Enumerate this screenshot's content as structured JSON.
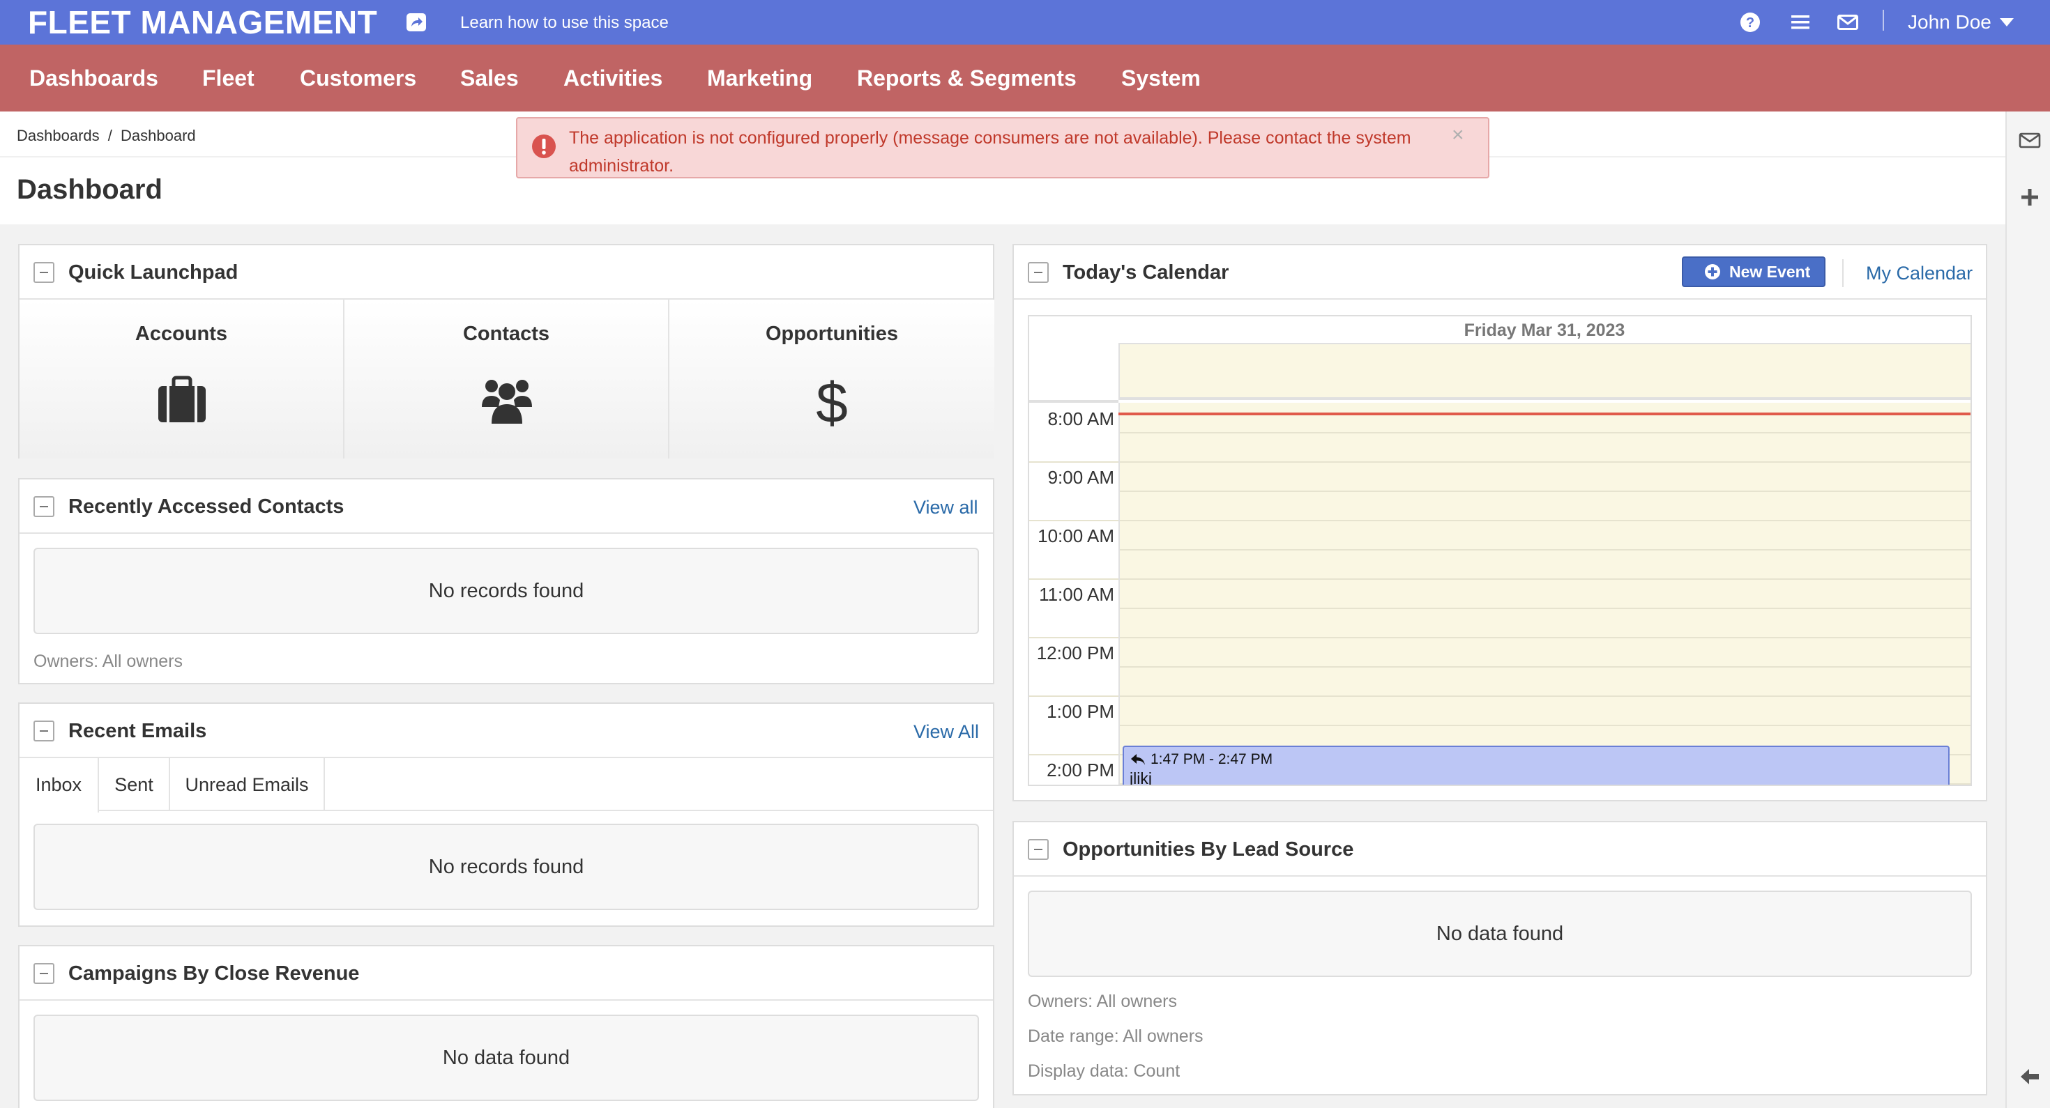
{
  "header": {
    "app_title": "FLEET MANAGEMENT",
    "learn_link": "Learn how to use this space",
    "user_name": "John Doe",
    "brand_color": "#5c74d8"
  },
  "nav": {
    "items": [
      "Dashboards",
      "Fleet",
      "Customers",
      "Sales",
      "Activities",
      "Marketing",
      "Reports & Segments",
      "System"
    ],
    "color": "#c06464"
  },
  "breadcrumb": {
    "parent": "Dashboards",
    "separator": "/",
    "current": "Dashboard"
  },
  "page": {
    "title": "Dashboard"
  },
  "alert": {
    "message": "The application is not configured properly (message consumers are not available). Please contact the system administrator.",
    "close": "×"
  },
  "quick_launchpad": {
    "title": "Quick Launchpad",
    "items": [
      {
        "label": "Accounts",
        "icon": "briefcase-icon"
      },
      {
        "label": "Contacts",
        "icon": "users-icon"
      },
      {
        "label": "Opportunities",
        "icon": "dollar-icon"
      }
    ]
  },
  "recent_contacts": {
    "title": "Recently Accessed Contacts",
    "link": "View all",
    "empty": "No records found",
    "owners": "Owners: All owners"
  },
  "recent_emails": {
    "title": "Recent Emails",
    "link": "View All",
    "tabs": [
      "Inbox",
      "Sent",
      "Unread Emails"
    ],
    "active_tab": "Inbox",
    "empty": "No records found"
  },
  "campaigns": {
    "title": "Campaigns By Close Revenue",
    "empty": "No data found"
  },
  "calendar": {
    "title": "Today's Calendar",
    "new_event": "New Event",
    "my_calendar": "My Calendar",
    "date": "Friday Mar 31, 2023",
    "times": [
      "8:00 AM",
      "9:00 AM",
      "10:00 AM",
      "11:00 AM",
      "12:00 PM",
      "1:00 PM",
      "2:00 PM"
    ],
    "event": {
      "time": "1:47 PM - 2:47 PM",
      "title": "jlikj"
    }
  },
  "opportunities_by_source": {
    "title": "Opportunities By Lead Source",
    "empty": "No data found",
    "owners": "Owners: All owners",
    "date_range": "Date range: All owners",
    "display_data": "Display data: Count"
  }
}
